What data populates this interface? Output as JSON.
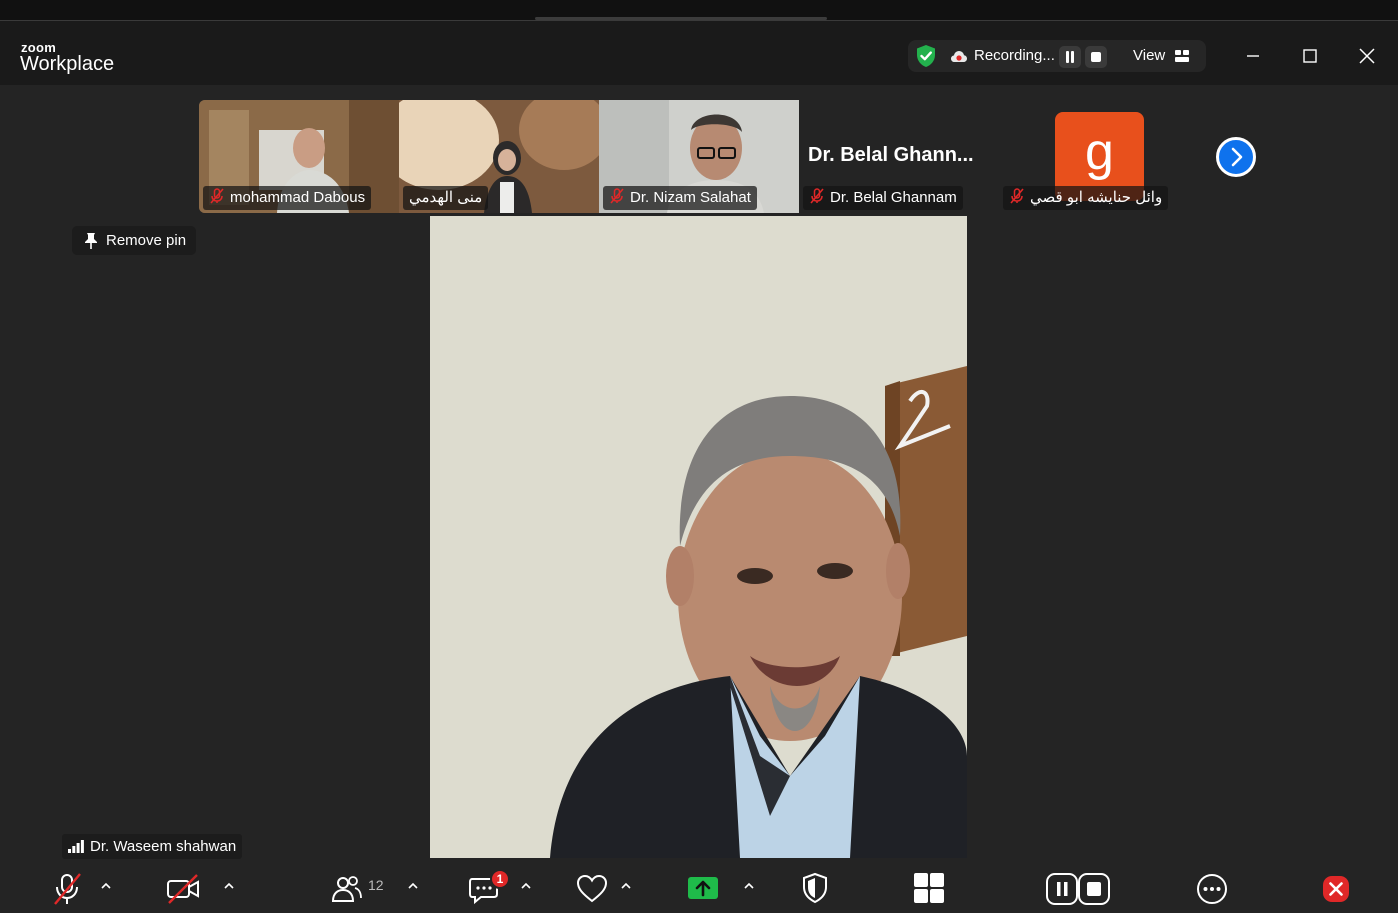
{
  "app": {
    "brand_small": "zoom",
    "brand_big": "Workplace"
  },
  "recording": {
    "label": "Recording..."
  },
  "view": {
    "label": "View"
  },
  "thumbnails": [
    {
      "name": "mohammad Dabous",
      "muted": true
    },
    {
      "name": "منى الهدمي",
      "muted": false
    },
    {
      "name": "Dr. Nizam Salahat",
      "muted": true
    },
    {
      "name": "Dr. Belal Ghannam",
      "muted": true,
      "big_name": "Dr. Belal Ghann..."
    },
    {
      "name": "وائل حنايشه ابو قصي",
      "muted": true,
      "avatar_letter": "g"
    }
  ],
  "pin": {
    "label": "Remove pin"
  },
  "speaker": {
    "name": "Dr. Waseem shahwan"
  },
  "toolbar": {
    "participants_count": "12",
    "chat_badge": "1"
  },
  "colors": {
    "accent": "#0e72ed",
    "avatar_bg": "#e8501c",
    "share_green": "#1fbb4a",
    "muted_red": "#e02828"
  }
}
